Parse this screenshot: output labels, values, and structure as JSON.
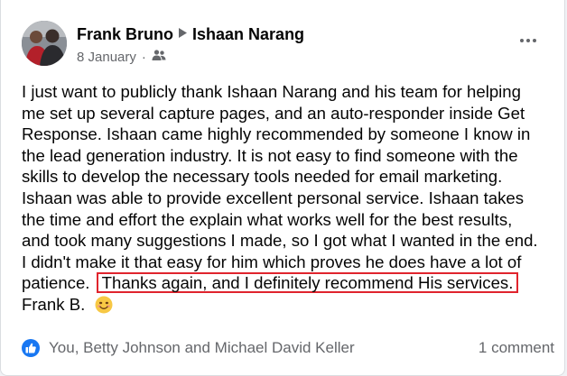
{
  "post": {
    "author": "Frank Bruno",
    "recipient": "Ishaan Narang",
    "date": "8 January",
    "separator": "·",
    "body_lines": [
      "I just want to publicly thank Ishaan Narang and his team for helping",
      "me set up several capture pages, and an auto-responder inside Get",
      "Response.   Ishaan came highly recommended by someone I know in",
      "the lead generation industry.  It is not easy to find someone with the",
      "skills to develop the necessary tools needed for email marketing.",
      "Ishaan was able to provide excellent personal service.   Ishaan takes",
      "the time and effort the explain what works well for the best results,",
      "and took many suggestions I made, so I got what I wanted in the end.",
      "I didn't make it that easy for him which proves he does have a lot of"
    ],
    "line10_prefix": "patience.",
    "highlighted_text": "Thanks again, and I definitely recommend His services.",
    "signature": "Frank B.",
    "reactions_text": "You, Betty Johnson and Michael David Keller",
    "comments_text": "1 comment"
  },
  "icons": {
    "audience": "friends-icon",
    "menu": "more-options-icon",
    "reaction": "like-icon",
    "emoji": "smiling-face-emoji"
  },
  "colors": {
    "highlight_border": "#e0242d",
    "like_badge": "#1877f2",
    "secondary_text": "#65676b"
  }
}
